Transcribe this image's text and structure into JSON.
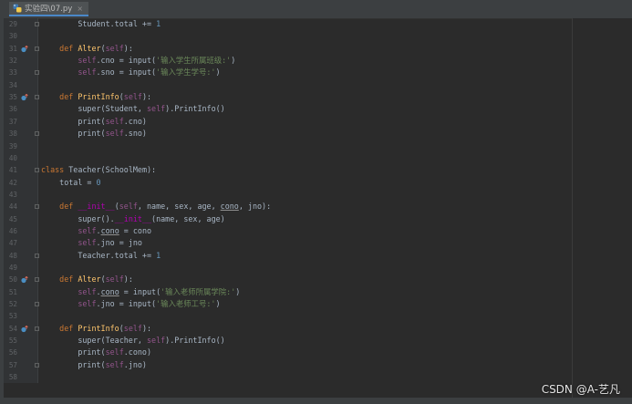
{
  "editor": {
    "tab": {
      "title": "实验四\\07.py",
      "icon": "python-file-icon",
      "close_icon": "close-icon",
      "close": "×"
    },
    "colors": {
      "background": "#2b2b2b",
      "keyword": "#cc7832",
      "function": "#ffc66d",
      "self": "#94558d",
      "string": "#6a8759",
      "number": "#6897bb",
      "text": "#a9b7c6",
      "line_number": "#606366"
    },
    "lines": [
      {
        "num": "29",
        "fold": true,
        "segments": [
          {
            "t": "        Student.total += "
          },
          {
            "t": "1",
            "c": "nm"
          }
        ]
      },
      {
        "num": "30",
        "segments": []
      },
      {
        "num": "31",
        "fold": true,
        "mark": "override-icon",
        "segments": [
          {
            "t": "    "
          },
          {
            "t": "def ",
            "c": "kw"
          },
          {
            "t": "Alter",
            "c": "fn"
          },
          {
            "t": "("
          },
          {
            "t": "self",
            "c": "sf"
          },
          {
            "t": "):"
          }
        ]
      },
      {
        "num": "32",
        "segments": [
          {
            "t": "        "
          },
          {
            "t": "self",
            "c": "sf"
          },
          {
            "t": ".cno = input("
          },
          {
            "t": "'输入学生所属班级:'",
            "c": "st"
          },
          {
            "t": ")"
          }
        ]
      },
      {
        "num": "33",
        "fold": true,
        "segments": [
          {
            "t": "        "
          },
          {
            "t": "self",
            "c": "sf"
          },
          {
            "t": ".sno = input("
          },
          {
            "t": "'输入学生学号:'",
            "c": "st"
          },
          {
            "t": ")"
          }
        ]
      },
      {
        "num": "34",
        "segments": []
      },
      {
        "num": "35",
        "fold": true,
        "mark": "override-icon",
        "segments": [
          {
            "t": "    "
          },
          {
            "t": "def ",
            "c": "kw"
          },
          {
            "t": "PrintInfo",
            "c": "fn"
          },
          {
            "t": "("
          },
          {
            "t": "self",
            "c": "sf"
          },
          {
            "t": "):"
          }
        ]
      },
      {
        "num": "36",
        "segments": [
          {
            "t": "        super(Student, "
          },
          {
            "t": "self",
            "c": "sf"
          },
          {
            "t": ").PrintInfo()"
          }
        ]
      },
      {
        "num": "37",
        "segments": [
          {
            "t": "        print("
          },
          {
            "t": "self",
            "c": "sf"
          },
          {
            "t": ".cno)"
          }
        ]
      },
      {
        "num": "38",
        "fold": true,
        "segments": [
          {
            "t": "        print("
          },
          {
            "t": "self",
            "c": "sf"
          },
          {
            "t": ".sno)"
          }
        ]
      },
      {
        "num": "39",
        "segments": []
      },
      {
        "num": "40",
        "segments": []
      },
      {
        "num": "41",
        "fold": true,
        "segments": [
          {
            "t": "class ",
            "c": "kw"
          },
          {
            "t": "Teacher(SchoolMem):"
          }
        ]
      },
      {
        "num": "42",
        "segments": [
          {
            "t": "    total = "
          },
          {
            "t": "0",
            "c": "nm"
          }
        ]
      },
      {
        "num": "43",
        "segments": []
      },
      {
        "num": "44",
        "fold": true,
        "segments": [
          {
            "t": "    "
          },
          {
            "t": "def ",
            "c": "kw"
          },
          {
            "t": "__init__",
            "c": "mg"
          },
          {
            "t": "("
          },
          {
            "t": "self",
            "c": "sf"
          },
          {
            "t": ", name, sex, age, "
          },
          {
            "t": "cono",
            "c": "ul"
          },
          {
            "t": ", jno):"
          }
        ]
      },
      {
        "num": "45",
        "segments": [
          {
            "t": "        super()."
          },
          {
            "t": "__init__",
            "c": "mg"
          },
          {
            "t": "(name, sex, age)"
          }
        ]
      },
      {
        "num": "46",
        "segments": [
          {
            "t": "        "
          },
          {
            "t": "self",
            "c": "sf"
          },
          {
            "t": "."
          },
          {
            "t": "cono",
            "c": "ul"
          },
          {
            "t": " = cono"
          }
        ]
      },
      {
        "num": "47",
        "segments": [
          {
            "t": "        "
          },
          {
            "t": "self",
            "c": "sf"
          },
          {
            "t": ".jno = jno"
          }
        ]
      },
      {
        "num": "48",
        "fold": true,
        "segments": [
          {
            "t": "        Teacher.total += "
          },
          {
            "t": "1",
            "c": "nm"
          }
        ]
      },
      {
        "num": "49",
        "segments": []
      },
      {
        "num": "50",
        "fold": true,
        "mark": "override-icon",
        "segments": [
          {
            "t": "    "
          },
          {
            "t": "def ",
            "c": "kw"
          },
          {
            "t": "Alter",
            "c": "fn"
          },
          {
            "t": "("
          },
          {
            "t": "self",
            "c": "sf"
          },
          {
            "t": "):"
          }
        ]
      },
      {
        "num": "51",
        "segments": [
          {
            "t": "        "
          },
          {
            "t": "self",
            "c": "sf"
          },
          {
            "t": "."
          },
          {
            "t": "cono",
            "c": "ul"
          },
          {
            "t": " = input("
          },
          {
            "t": "'输入老师所属学院:'",
            "c": "st"
          },
          {
            "t": ")"
          }
        ]
      },
      {
        "num": "52",
        "fold": true,
        "segments": [
          {
            "t": "        "
          },
          {
            "t": "self",
            "c": "sf"
          },
          {
            "t": ".jno = input("
          },
          {
            "t": "'输入老师工号:'",
            "c": "st"
          },
          {
            "t": ")"
          }
        ]
      },
      {
        "num": "53",
        "segments": []
      },
      {
        "num": "54",
        "fold": true,
        "mark": "override-icon",
        "segments": [
          {
            "t": "    "
          },
          {
            "t": "def ",
            "c": "kw"
          },
          {
            "t": "PrintInfo",
            "c": "fn"
          },
          {
            "t": "("
          },
          {
            "t": "self",
            "c": "sf"
          },
          {
            "t": "):"
          }
        ]
      },
      {
        "num": "55",
        "segments": [
          {
            "t": "        super(Teacher, "
          },
          {
            "t": "self",
            "c": "sf"
          },
          {
            "t": ").PrintInfo()"
          }
        ]
      },
      {
        "num": "56",
        "segments": [
          {
            "t": "        print("
          },
          {
            "t": "self",
            "c": "sf"
          },
          {
            "t": ".cono)"
          }
        ]
      },
      {
        "num": "57",
        "fold": true,
        "segments": [
          {
            "t": "        print("
          },
          {
            "t": "self",
            "c": "sf"
          },
          {
            "t": ".jno)"
          }
        ]
      },
      {
        "num": "58",
        "segments": []
      }
    ]
  },
  "watermark": "CSDN @A-艺凡"
}
